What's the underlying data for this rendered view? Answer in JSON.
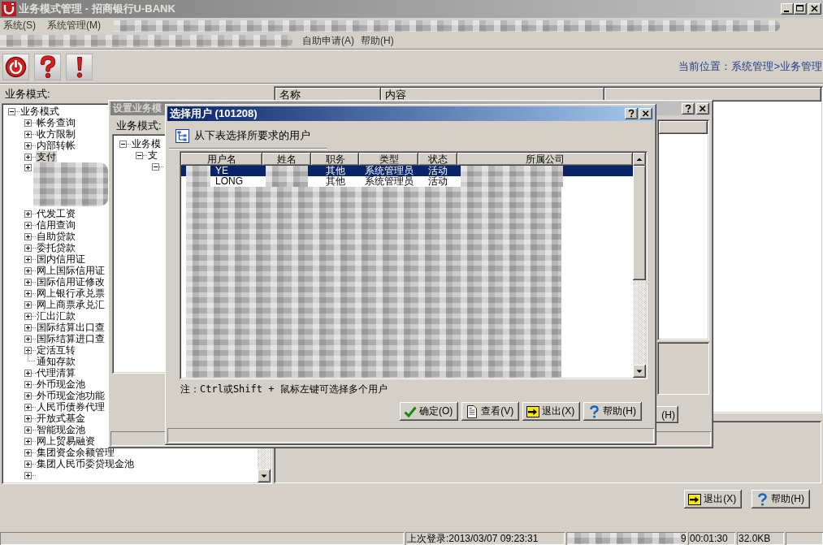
{
  "window": {
    "title": "业务模式管理 - 招商银行U-BANK"
  },
  "menu": {
    "row_1": [
      "系统(S)",
      "系统管理(M)"
    ],
    "row_2": [
      "自助申请(A)",
      "帮助(H)"
    ]
  },
  "toolbar": {
    "buttons": [
      {
        "kind": "power"
      },
      {
        "kind": "help"
      },
      {
        "kind": "alert"
      }
    ],
    "location": "当前位置：系统管理>业务管理"
  },
  "left_panel": {
    "label": "业务模式:",
    "tree": [
      {
        "kind": "branch",
        "label": "业务模式",
        "expanded": true,
        "selected": false,
        "children": [
          {
            "kind": "branch",
            "label": "帐务查询",
            "expanded": false,
            "selected": false
          },
          {
            "kind": "branch",
            "label": "收方限制",
            "expanded": false,
            "selected": false
          },
          {
            "kind": "branch",
            "label": "内部转帐",
            "expanded": false,
            "selected": false
          },
          {
            "kind": "branch",
            "label": "支付",
            "expanded": false,
            "selected": true
          },
          {
            "kind": "blurred",
            "expanded": false
          },
          {
            "kind": "branch",
            "label": "代发工资",
            "expanded": false,
            "selected": false
          },
          {
            "kind": "branch",
            "label": "信用查询",
            "expanded": false,
            "selected": false
          },
          {
            "kind": "branch",
            "label": "自助贷款",
            "expanded": false,
            "selected": false
          },
          {
            "kind": "branch",
            "label": "委托贷款",
            "expanded": false,
            "selected": false
          },
          {
            "kind": "branch",
            "label": "国内信用证",
            "expanded": false,
            "selected": false
          },
          {
            "kind": "branch",
            "label": "网上国际信用证",
            "expanded": false,
            "selected": false
          },
          {
            "kind": "branch",
            "label": "国际信用证修改",
            "expanded": false,
            "selected": false
          },
          {
            "kind": "branch",
            "label": "网上银行承兑票",
            "expanded": false,
            "selected": false
          },
          {
            "kind": "branch",
            "label": "网上商票承兑汇",
            "expanded": false,
            "selected": false
          },
          {
            "kind": "branch",
            "label": "汇出汇款",
            "expanded": false,
            "selected": false
          },
          {
            "kind": "branch",
            "label": "国际结算出口查",
            "expanded": false,
            "selected": false
          },
          {
            "kind": "branch",
            "label": "国际结算进口查",
            "expanded": false,
            "selected": false
          },
          {
            "kind": "branch",
            "label": "定活互转",
            "expanded": false,
            "selected": false
          },
          {
            "kind": "leaf",
            "label": "通知存款",
            "selected": false
          },
          {
            "kind": "branch",
            "label": "代理清算",
            "expanded": false,
            "selected": false
          },
          {
            "kind": "branch",
            "label": "外币现金池",
            "expanded": false,
            "selected": false
          },
          {
            "kind": "branch",
            "label": "外币现金池功能",
            "expanded": false,
            "selected": false
          },
          {
            "kind": "branch",
            "label": "人民币债券代理",
            "expanded": false,
            "selected": false
          },
          {
            "kind": "branch",
            "label": "开放式基金",
            "expanded": false,
            "selected": false
          },
          {
            "kind": "branch",
            "label": "智能现金池",
            "expanded": false,
            "selected": false
          },
          {
            "kind": "branch",
            "label": "网上贸易融资",
            "expanded": false,
            "selected": false
          },
          {
            "kind": "branch",
            "label": "集团资金余额管理",
            "expanded": false,
            "selected": false
          },
          {
            "kind": "branch",
            "label": "集团人民币委贷现金池",
            "expanded": false,
            "selected": false
          },
          {
            "kind": "branch",
            "expanded": false
          }
        ]
      }
    ]
  },
  "right_panel": {
    "columns": [
      "名称",
      "内容"
    ]
  },
  "setup_dialog": {
    "title": "设置业务模",
    "label": "业务模式:",
    "tree": [
      {
        "kind": "branch",
        "label": "业务模",
        "expanded": true,
        "selected": false,
        "children": [
          {
            "kind": "branch",
            "label": "支",
            "expanded": true,
            "selected": false,
            "children": [
              {
                "kind": "branch",
                "expanded": true
              }
            ]
          }
        ]
      }
    ],
    "buttons": [
      {
        "label": "(H)"
      }
    ]
  },
  "select_dialog": {
    "title": "选择用户 (101208)",
    "instruction": "从下表选择所要求的用户",
    "table": {
      "columns": [
        "用户名",
        "姓名",
        "职务",
        "类型",
        "状态",
        "所属公司"
      ],
      "rows": [
        {
          "selected": true,
          "cells": [
            {
              "kind": "blurred_prefix",
              "text": "YE"
            },
            {
              "kind": "blurred"
            },
            {
              "kind": "text",
              "text": "其他"
            },
            {
              "kind": "text",
              "text": "系统管理员"
            },
            {
              "kind": "text",
              "text": "活动"
            },
            {
              "kind": "blurred"
            }
          ]
        },
        {
          "selected": false,
          "cells": [
            {
              "kind": "blurred_prefix",
              "text": "LONG"
            },
            {
              "kind": "blurred"
            },
            {
              "kind": "text",
              "text": "其他"
            },
            {
              "kind": "text",
              "text": "系统管理员"
            },
            {
              "kind": "text",
              "text": "活动"
            },
            {
              "kind": "blurred"
            }
          ]
        }
      ]
    },
    "note": "注：Ctrl或Shift + 鼠标左键可选择多个用户",
    "buttons": [
      {
        "kind": "ok",
        "label": "确定(O)"
      },
      {
        "kind": "view",
        "label": "查看(V)"
      },
      {
        "kind": "exit",
        "label": "退出(X)"
      },
      {
        "kind": "help",
        "label": "帮助(H)"
      }
    ]
  },
  "bottom_buttons": [
    {
      "kind": "exit",
      "label": "退出(X)"
    },
    {
      "kind": "help",
      "label": "帮助(H)"
    }
  ],
  "status_bar": [
    {
      "kind": "empty"
    },
    {
      "kind": "text",
      "text": "上次登录:2013/03/07 09:23:31"
    },
    {
      "kind": "blurred_prefix",
      "text": "9"
    },
    {
      "kind": "text",
      "text": "00:01:30"
    },
    {
      "kind": "text",
      "text": "32.0KB"
    },
    {
      "kind": "empty"
    }
  ]
}
